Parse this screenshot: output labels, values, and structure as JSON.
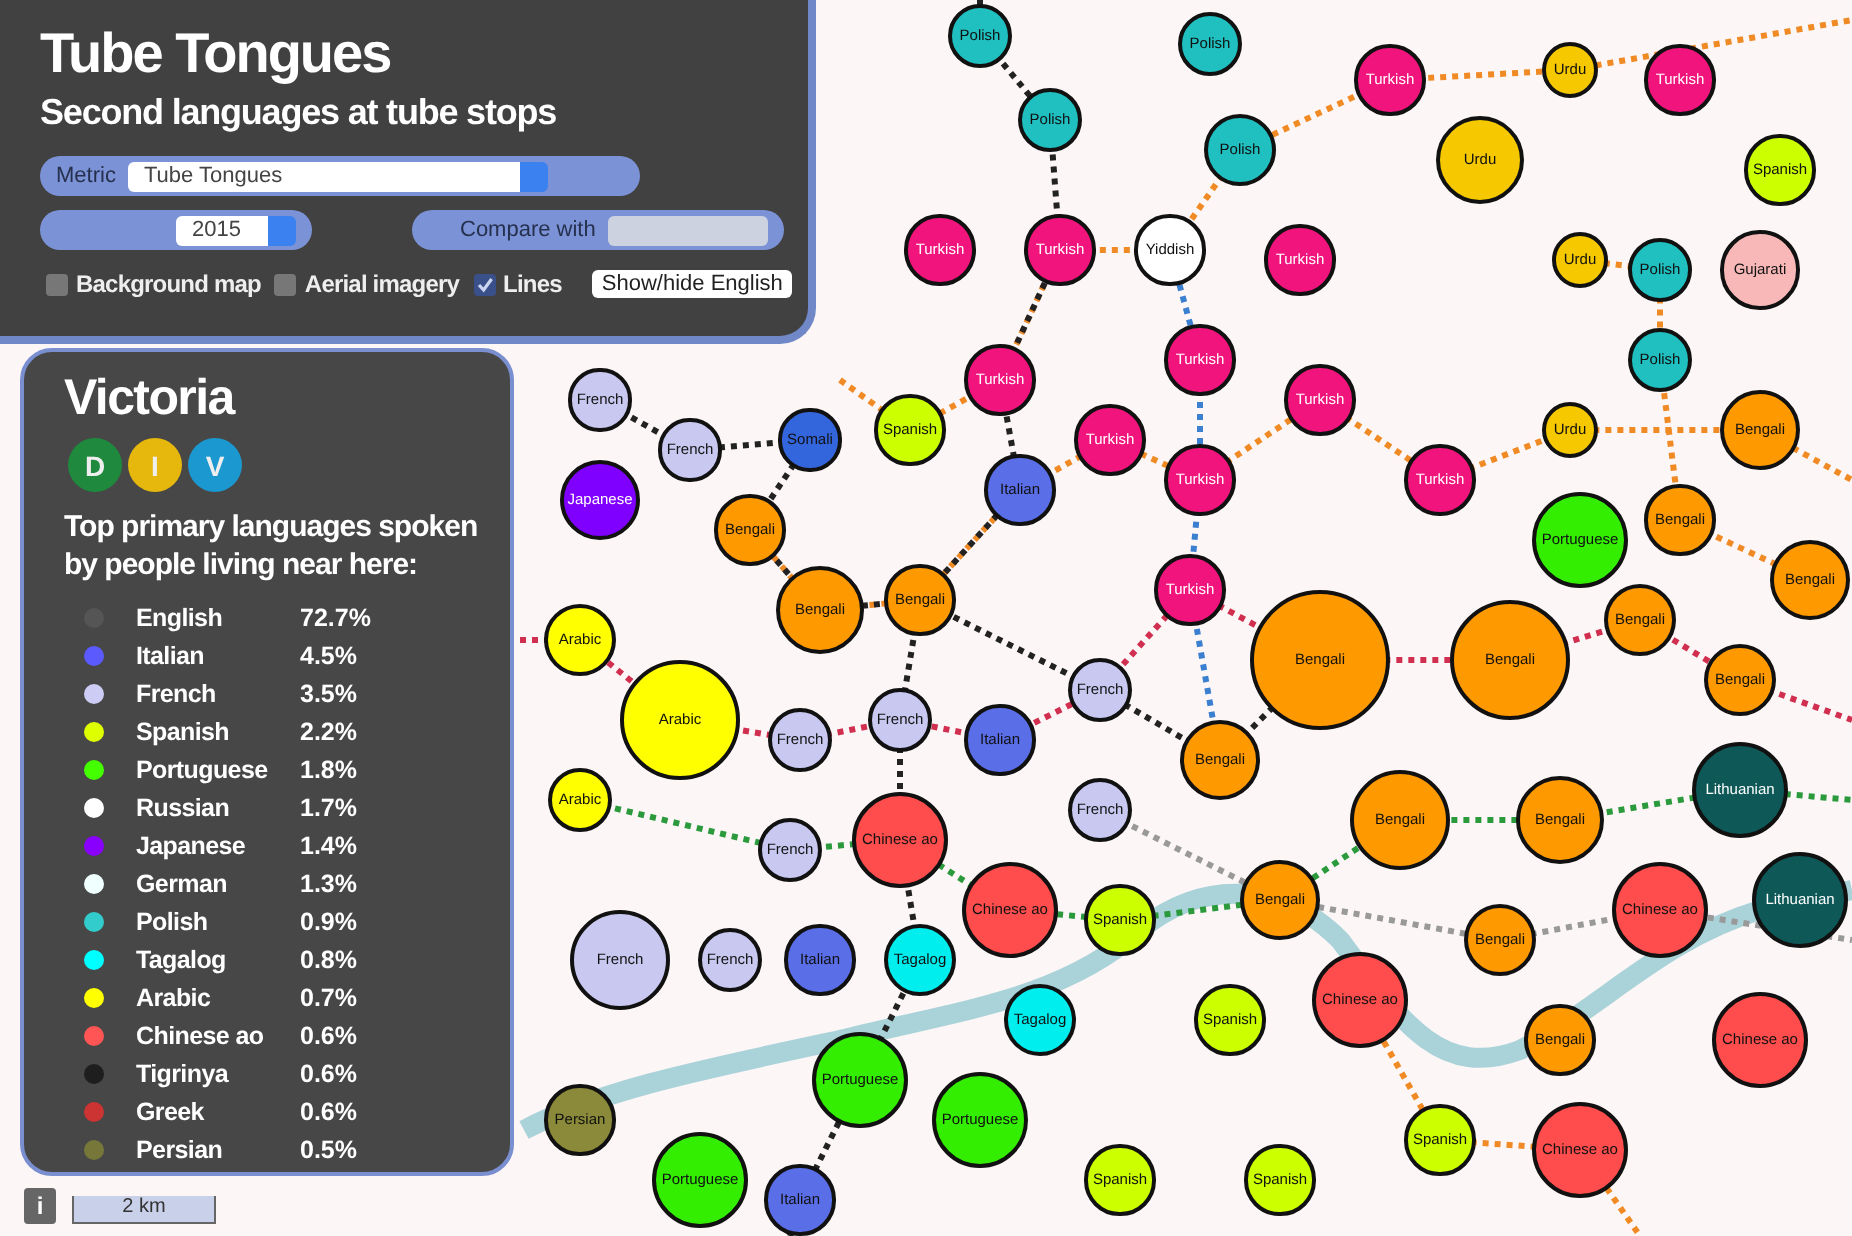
{
  "header": {
    "title": "Tube Tongues",
    "subtitle": "Second languages at tube stops"
  },
  "controls": {
    "metric_label": "Metric",
    "metric_value": "Tube Tongues",
    "year_value": "2015",
    "compare_label": "Compare with",
    "checkboxes": [
      {
        "label": "Background map",
        "checked": false
      },
      {
        "label": "Aerial imagery",
        "checked": false
      },
      {
        "label": "Lines",
        "checked": true
      }
    ],
    "toggle_button": "Show/hide English"
  },
  "station_panel": {
    "name": "Victoria",
    "lines": [
      {
        "letter": "D",
        "color": "#1f8a3e"
      },
      {
        "letter": "I",
        "color": "#e6b80e"
      },
      {
        "letter": "V",
        "color": "#1b98cf"
      }
    ],
    "heading": "Top primary languages spoken by people living near here:",
    "languages": [
      {
        "name": "English",
        "share": "72.7%",
        "color": "#555555"
      },
      {
        "name": "Italian",
        "share": "4.5%",
        "color": "#5a5aff"
      },
      {
        "name": "French",
        "share": "3.5%",
        "color": "#ccccf5"
      },
      {
        "name": "Spanish",
        "share": "2.2%",
        "color": "#ddff00"
      },
      {
        "name": "Portuguese",
        "share": "1.8%",
        "color": "#44ff00"
      },
      {
        "name": "Russian",
        "share": "1.7%",
        "color": "#ffffff"
      },
      {
        "name": "Japanese",
        "share": "1.4%",
        "color": "#8a00ff"
      },
      {
        "name": "German",
        "share": "1.3%",
        "color": "#f0ffff"
      },
      {
        "name": "Polish",
        "share": "0.9%",
        "color": "#33cccc"
      },
      {
        "name": "Tagalog",
        "share": "0.8%",
        "color": "#00ffff"
      },
      {
        "name": "Arabic",
        "share": "0.7%",
        "color": "#ffff00"
      },
      {
        "name": "Chinese ao",
        "share": "0.6%",
        "color": "#ff5555"
      },
      {
        "name": "Tigrinya",
        "share": "0.6%",
        "color": "#1e1e1e"
      },
      {
        "name": "Greek",
        "share": "0.6%",
        "color": "#cc3333"
      },
      {
        "name": "Persian",
        "share": "0.5%",
        "color": "#77773a"
      }
    ]
  },
  "map": {
    "info_button": "i",
    "scale": "2 km",
    "stations": [
      {
        "label": "Polish",
        "color": "#20c0c0"
      },
      {
        "label": "Polish",
        "color": "#20c0c0"
      },
      {
        "label": "Turkish",
        "color": "#f0147c"
      },
      {
        "label": "Polish",
        "color": "#20c0c0"
      },
      {
        "label": "Polish",
        "color": "#20c0c0"
      },
      {
        "label": "Yiddish",
        "color": "#ffffff"
      },
      {
        "label": "Turkish",
        "color": "#f0147c"
      },
      {
        "label": "Turkish",
        "color": "#f0147c"
      },
      {
        "label": "Urdu",
        "color": "#f5c800"
      },
      {
        "label": "Urdu",
        "color": "#f5c800"
      },
      {
        "label": "Turkish",
        "color": "#f0147c"
      },
      {
        "label": "Spanish",
        "color": "#ccff00"
      },
      {
        "label": "Gujarati",
        "color": "#f8b8b8"
      },
      {
        "label": "Polish",
        "color": "#20c0c0"
      },
      {
        "label": "Urdu",
        "color": "#f5c800"
      },
      {
        "label": "Polish",
        "color": "#20c0c0"
      },
      {
        "label": "Turkish",
        "color": "#f0147c"
      },
      {
        "label": "Urdu",
        "color": "#f5c800"
      },
      {
        "label": "Turkish",
        "color": "#f0147c"
      },
      {
        "label": "Turkish",
        "color": "#f0147c"
      },
      {
        "label": "Turkish",
        "color": "#f0147c"
      },
      {
        "label": "Turkish",
        "color": "#f0147c"
      },
      {
        "label": "Turkish",
        "color": "#f0147c"
      },
      {
        "label": "Bengali",
        "color": "#ff9900"
      },
      {
        "label": "Bengali",
        "color": "#ff9900"
      },
      {
        "label": "Bengali",
        "color": "#ff9900"
      },
      {
        "label": "Spanish",
        "color": "#ccff00"
      },
      {
        "label": "Italian",
        "color": "#5a6ee8"
      },
      {
        "label": "Turkish",
        "color": "#f0147c"
      },
      {
        "label": "Somali",
        "color": "#3366dd"
      },
      {
        "label": "Bengali",
        "color": "#ff9900"
      },
      {
        "label": "French",
        "color": "#c8c8f0"
      },
      {
        "label": "Japanese",
        "color": "#8000ff"
      },
      {
        "label": "French",
        "color": "#c8c8f0"
      },
      {
        "label": "Turkish",
        "color": "#f0147c"
      },
      {
        "label": "Bengali",
        "color": "#ff9900"
      },
      {
        "label": "Bengali",
        "color": "#ff9900"
      },
      {
        "label": "Bengali",
        "color": "#ff9900"
      },
      {
        "label": "Bengali",
        "color": "#ff9900"
      },
      {
        "label": "Bengali",
        "color": "#ff9900"
      },
      {
        "label": "Portuguese",
        "color": "#33ee00"
      },
      {
        "label": "Bengali",
        "color": "#ff9900"
      },
      {
        "label": "Lithuanian",
        "color": "#0e5858"
      },
      {
        "label": "Lithuanian",
        "color": "#0e5858"
      },
      {
        "label": "Bengali",
        "color": "#ff9900"
      },
      {
        "label": "Bengali",
        "color": "#ff9900"
      },
      {
        "label": "Bengali",
        "color": "#ff9900"
      },
      {
        "label": "Chinese ao",
        "color": "#ff4d4d"
      },
      {
        "label": "Bengali",
        "color": "#ff9900"
      },
      {
        "label": "Bengali",
        "color": "#ff9900"
      },
      {
        "label": "Chinese ao",
        "color": "#ff4d4d"
      },
      {
        "label": "Spanish",
        "color": "#ccff00"
      },
      {
        "label": "Bengali",
        "color": "#ff9900"
      },
      {
        "label": "Chinese ao",
        "color": "#ff4d4d"
      },
      {
        "label": "Spanish",
        "color": "#ccff00"
      },
      {
        "label": "Spanish",
        "color": "#ccff00"
      },
      {
        "label": "Arabic",
        "color": "#ffff00"
      },
      {
        "label": "Arabic",
        "color": "#ffff00"
      },
      {
        "label": "French",
        "color": "#c8c8f0"
      },
      {
        "label": "French",
        "color": "#c8c8f0"
      },
      {
        "label": "Italian",
        "color": "#5a6ee8"
      },
      {
        "label": "French",
        "color": "#c8c8f0"
      },
      {
        "label": "Arabic",
        "color": "#ffff00"
      },
      {
        "label": "French",
        "color": "#c8c8f0"
      },
      {
        "label": "Chinese ao",
        "color": "#ff4d4d"
      },
      {
        "label": "French",
        "color": "#c8c8f0"
      },
      {
        "label": "Chinese ao",
        "color": "#ff4d4d"
      },
      {
        "label": "Tagalog",
        "color": "#00eeee"
      },
      {
        "label": "Spanish",
        "color": "#ccff00"
      },
      {
        "label": "French",
        "color": "#c8c8f0"
      },
      {
        "label": "French",
        "color": "#c8c8f0"
      },
      {
        "label": "Italian",
        "color": "#5a6ee8"
      },
      {
        "label": "Tagalog",
        "color": "#00eeee"
      },
      {
        "label": "Portuguese",
        "color": "#33ee00"
      },
      {
        "label": "Portuguese",
        "color": "#33ee00"
      },
      {
        "label": "Persian",
        "color": "#8a8a3a"
      },
      {
        "label": "Portuguese",
        "color": "#33ee00"
      },
      {
        "label": "Italian",
        "color": "#5a6ee8"
      },
      {
        "label": "Spanish",
        "color": "#ccff00"
      },
      {
        "label": "Chinese ao",
        "color": "#ff4d4d"
      }
    ]
  }
}
